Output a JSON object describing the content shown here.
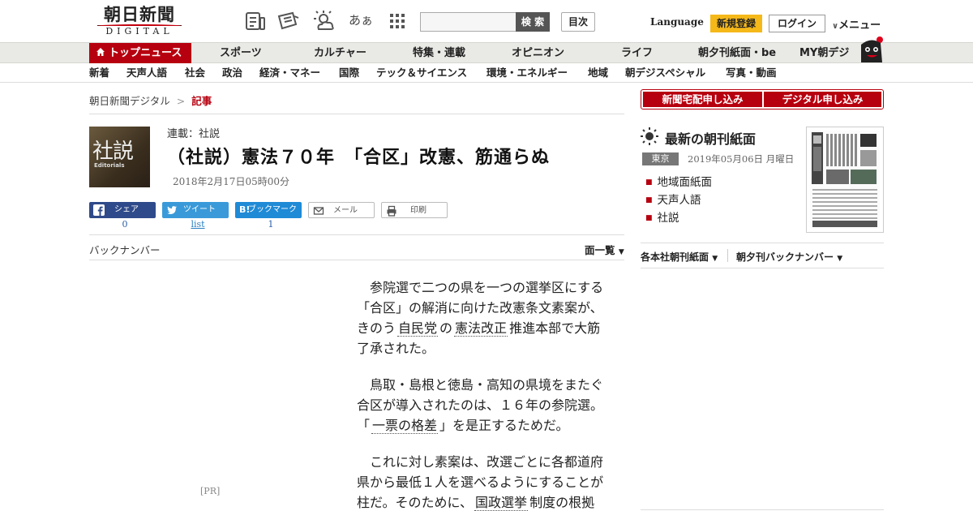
{
  "header": {
    "logo_jp": "朝日新聞",
    "logo_en": "DIGITAL",
    "search_placeholder": "",
    "search_label": "検 索",
    "index_label": "目次",
    "language_label": "Language",
    "register_label": "新規登録",
    "login_label": "ログイン",
    "menu_label": "メニュー",
    "font_size_icon_label": "あぁ"
  },
  "nav_main": {
    "top_news": "トップニュース",
    "items": [
      "スポーツ",
      "カルチャー",
      "特集・連載",
      "オピニオン",
      "ライフ",
      "朝夕刊紙面・be",
      "MY朝デジ"
    ]
  },
  "nav_sub": {
    "items": [
      "新着",
      "天声人語",
      "社会",
      "政治",
      "経済・マネー",
      "国際",
      "テック＆サイエンス",
      "環境・エネルギー",
      "地域",
      "朝デジスペシャル",
      "写真・動画"
    ]
  },
  "breadcrumb": {
    "home": "朝日新聞デジタル",
    "separator": ">",
    "current": "記事"
  },
  "article": {
    "thumb_jp": "社説",
    "thumb_en": "Editorials",
    "series": "連載：社説",
    "headline": "（社説）憲法７０年　「合区」改憲、筋通らぬ",
    "timestamp": "2018年2月17日05時00分",
    "paragraphs": [
      {
        "before": "参院選で二つの県を一つの選挙区にする「合区」の解消に向けた改憲条文素案が、きのう",
        "kw1": "自民党",
        "mid": "の",
        "kw2": "憲法改正",
        "after": "推進本部で大筋了承された。"
      },
      {
        "before": "鳥取・島根と徳島・高知の県境をまたぐ合区が導入されたのは、１６年の参院選。「",
        "kw1": "一票の格差",
        "mid": "",
        "kw2": "",
        "after": "」を是正するためだ。"
      },
      {
        "before": "これに対し素案は、改選ごとに各都道府県から最低１人を選べるようにすることが柱だ。そのために、",
        "kw1": "国政選挙",
        "mid": "",
        "kw2": "",
        "after": "制度の根拠"
      }
    ]
  },
  "share": {
    "facebook": {
      "label": "シェア",
      "count": "0"
    },
    "twitter": {
      "label": "ツイート",
      "count": "list"
    },
    "hatena": {
      "label": "ブックマーク",
      "count": "1"
    },
    "mail": {
      "label": "メール"
    },
    "print": {
      "label": "印刷"
    }
  },
  "backnumber_label": "バックナンバー",
  "page_list_label": "面一覧",
  "pr_label": "[PR]",
  "sidebar": {
    "subscribe_paper": "新聞宅配申し込み",
    "subscribe_digital": "デジタル申し込み",
    "paper_title": "最新の朝刊紙面",
    "edition": "東京",
    "date": "2019年05月06日 月曜日",
    "links": [
      "地域面紙面",
      "天声人語",
      "社説"
    ],
    "honsha_link": "各本社朝刊紙面",
    "bn_link": "朝夕刊バックナンバー"
  },
  "colors": {
    "brand_red": "#b7000f",
    "register_yellow": "#f5b819",
    "facebook_blue": "#2f4a8a",
    "twitter_blue": "#3a9ad9",
    "hatena_blue": "#1f8ad6"
  }
}
